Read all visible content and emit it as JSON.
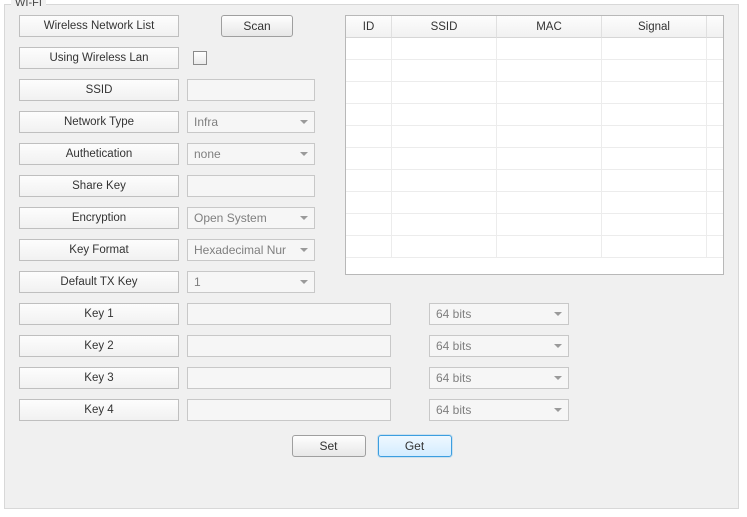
{
  "legend": "WI-FI",
  "labels": {
    "wireless_network_list": "Wireless Network List",
    "using_wireless_lan": "Using Wireless Lan",
    "ssid": "SSID",
    "network_type": "Network Type",
    "authentication": "Authetication",
    "share_key": "Share Key",
    "encryption": "Encryption",
    "key_format": "Key Format",
    "default_tx_key": "Default TX Key",
    "key1": "Key 1",
    "key2": "Key 2",
    "key3": "Key 3",
    "key4": "Key 4"
  },
  "buttons": {
    "scan": "Scan",
    "set": "Set",
    "get": "Get"
  },
  "values": {
    "network_type": "Infra",
    "authentication": "none",
    "encryption": "Open System",
    "key_format": "Hexadecimal Number",
    "key_format_display": "Hexadecimal Nur",
    "default_tx_key": "1",
    "key_bits": "64 bits"
  },
  "table": {
    "columns": [
      "ID",
      "SSID",
      "MAC",
      "Signal"
    ]
  }
}
